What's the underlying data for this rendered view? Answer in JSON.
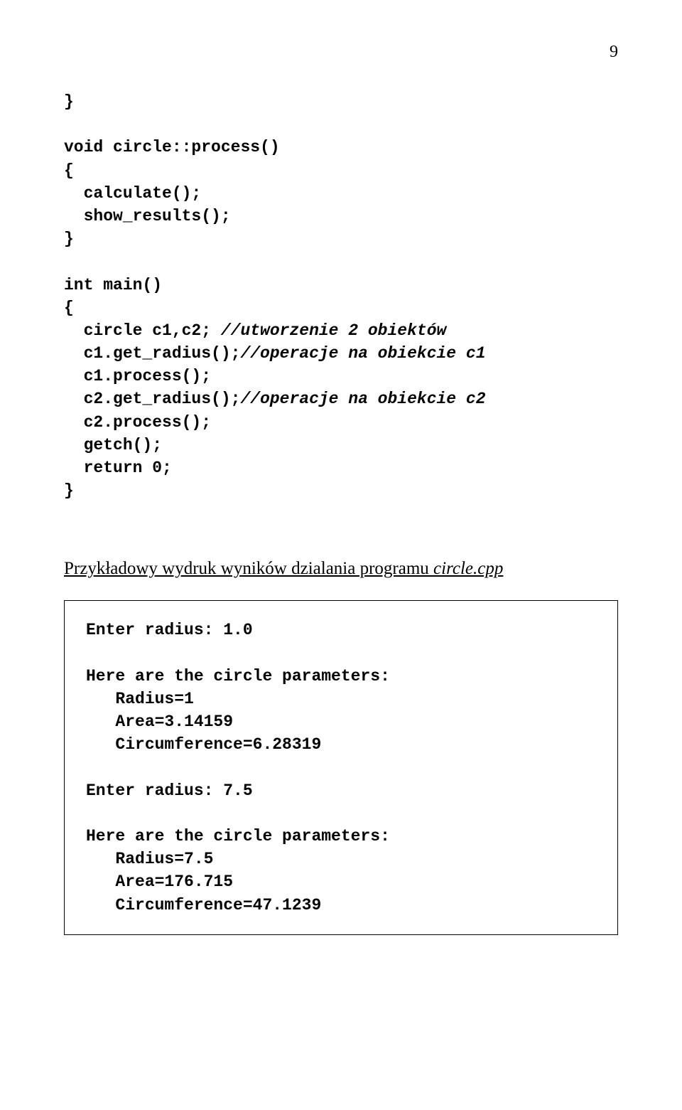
{
  "pageNumber": "9",
  "code": {
    "l01": "}",
    "l02": "void circle::process()",
    "l03": "{",
    "l04": "  calculate();",
    "l05": "  show_results();",
    "l06": "}",
    "l07": "int main()",
    "l08": "{",
    "l09a": "  circle c1,c2; ",
    "l09b": "//utworzenie 2 obiektów",
    "l10a": "  c1.get_radius();",
    "l10b": "//operacje na obiekcie c1",
    "l11": "  c1.process();",
    "l12a": "  c2.get_radius();",
    "l12b": "//operacje na obiekcie c2",
    "l13": "  c2.process();",
    "l14": "  getch();",
    "l15": "  return 0;",
    "l16": "}"
  },
  "sectionTitle": {
    "prefix": "Przykładowy wydruk wyników dzialania programu ",
    "italic": "circle.cpp"
  },
  "output": {
    "l1": "Enter radius: 1.0",
    "l2": "Here are the circle parameters:",
    "l3": "   Radius=1",
    "l4": "   Area=3.14159",
    "l5": "   Circumference=6.28319",
    "l6": "Enter radius: 7.5",
    "l7": "Here are the circle parameters:",
    "l8": "   Radius=7.5",
    "l9": "   Area=176.715",
    "l10": "   Circumference=47.1239"
  }
}
